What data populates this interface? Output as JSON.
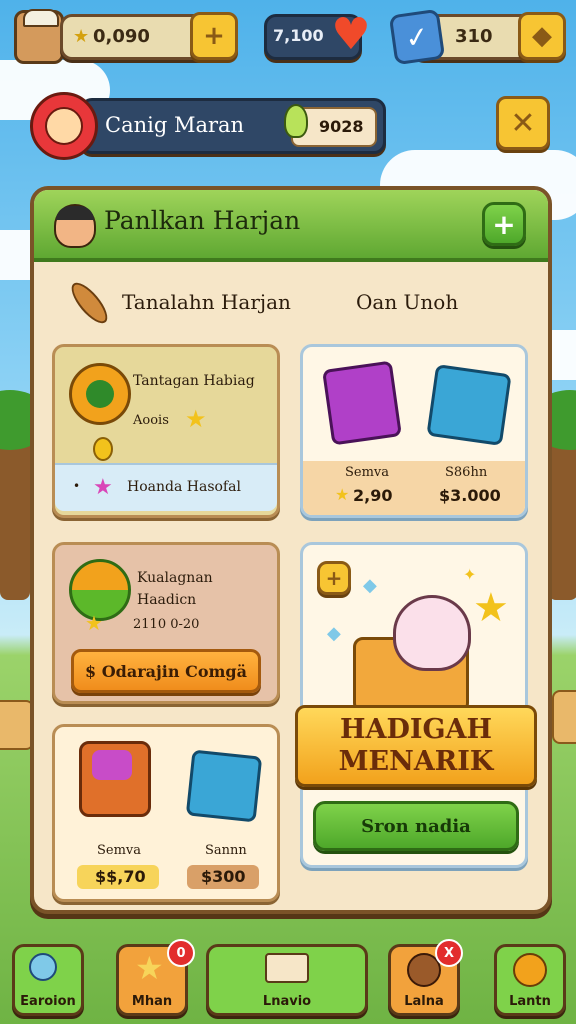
{
  "top_bar": {
    "coins": "0,090",
    "hearts": "7,100",
    "gems": "310"
  },
  "profile": {
    "name": "Canig Maran",
    "energy": "9028"
  },
  "panel": {
    "title": "Panlkan Harjan",
    "section_left": "Tanalahn Harjan",
    "section_right": "Oan Unoh"
  },
  "quest_card": {
    "title": "Tantagan Habiag",
    "reward": "Aoois",
    "footer": "Hoanda Hasofal"
  },
  "shop_card": {
    "item1_label": "Semva",
    "item1_price": "2,90",
    "item2_label": "S86hn",
    "item2_price": "$3.000"
  },
  "progress_card": {
    "title": "Kualagnan Haadicn",
    "stats": "2110 0-20",
    "button": "$ Odarajin Comgä"
  },
  "reward_card": {
    "banner_line1": "HADIGAH",
    "banner_line2": "MENARIK",
    "button": "Sron nadia"
  },
  "bundle_card": {
    "item1_label": "Semva",
    "item1_price": "$$,70",
    "item2_label": "Sannn",
    "item2_price": "$300"
  },
  "bottom_nav": [
    {
      "label": "Earoion"
    },
    {
      "label": "Mhan",
      "badge": "0"
    },
    {
      "label": "Lnavio"
    },
    {
      "label": "Lalna",
      "badge": "X"
    },
    {
      "label": "Lantn"
    }
  ]
}
